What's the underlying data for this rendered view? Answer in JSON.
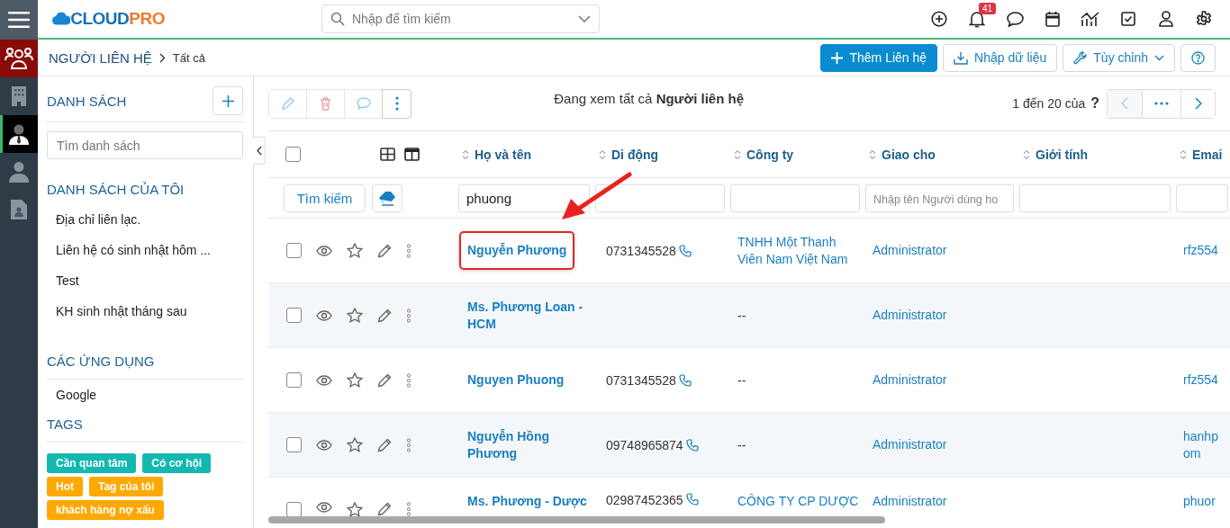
{
  "rail": [
    {
      "kind": "menu",
      "selected": false
    },
    {
      "kind": "module",
      "selected": false
    },
    {
      "kind": "organizations",
      "selected": false
    },
    {
      "kind": "contacts",
      "selected": true
    },
    {
      "kind": "leads",
      "selected": false
    },
    {
      "kind": "documents",
      "selected": false
    }
  ],
  "topbar": {
    "logo": {
      "part_1": "CLOUD",
      "part_2": "PRO"
    },
    "search": {
      "placeholder": "Nhập để tìm kiếm"
    },
    "icons": [
      {
        "kind": "add"
      },
      {
        "kind": "notifications",
        "badge": "41"
      },
      {
        "kind": "chat"
      },
      {
        "kind": "calendar"
      },
      {
        "kind": "reports"
      },
      {
        "kind": "tasks"
      },
      {
        "kind": "profile"
      },
      {
        "kind": "settings"
      }
    ]
  },
  "breadcrumb": {
    "module": "NGƯỜI LIÊN HỆ",
    "view": "Tất cả"
  },
  "actions": [
    {
      "kind": "primary",
      "label": "Thêm Liên hệ"
    },
    {
      "kind": "import",
      "label": "Nhập dữ liệu"
    },
    {
      "kind": "dropdown",
      "label": "Tùy chỉnh"
    },
    {
      "kind": "help"
    }
  ],
  "sidebar": {
    "lists_title": "DANH SÁCH",
    "list_search": {
      "placeholder": "Tìm danh sách"
    },
    "my_lists_title": "DANH SÁCH CỦA TÔI",
    "my_lists": [
      "Địa chỉ liên lạc.",
      "Liên hệ có sinh nhật hôm ...",
      "Test",
      "KH sinh nhật tháng sau"
    ],
    "apps_title": "CÁC ỨNG DỤNG",
    "apps": [
      "Google"
    ],
    "tags_title": "TAGS",
    "tags": [
      {
        "label": "Cần quan tâm",
        "color": "#14b8b0"
      },
      {
        "label": "Có cơ hội",
        "color": "#14b8b0"
      },
      {
        "label": "Hot",
        "color": "#ffa800"
      },
      {
        "label": "Tag của tôi",
        "color": "#ffa800"
      },
      {
        "label": "khách hàng nợ xấu",
        "color": "#ffa800"
      }
    ]
  },
  "toolbar": {
    "status": "Đang xem tất cả **Người liên hệ**",
    "range": "1 đến 20 của",
    "total": "?",
    "pager": [
      {
        "kind": "prev",
        "disabled": true
      },
      {
        "kind": "more",
        "disabled": false
      },
      {
        "kind": "next",
        "disabled": false
      }
    ]
  },
  "table": {
    "select_all": {
      "checked": false
    },
    "columns": [
      "Họ và tên",
      "Di động",
      "Công ty",
      "Giao cho",
      "Giới tính",
      "Emai"
    ],
    "search_button": "Tìm kiếm",
    "filters": [
      {
        "kind": "text",
        "value": "phuong"
      },
      {
        "kind": "text"
      },
      {
        "kind": "text"
      },
      {
        "kind": "text",
        "placeholder": "Nhập tên Người dùng ho"
      },
      {
        "kind": "text"
      },
      {
        "kind": "text"
      }
    ],
    "rows": [
      {
        "checked": false,
        "starred": false,
        "highlighted": true,
        "name": "Nguyễn Phương",
        "mobile": "0731345528",
        "company": "TNHH Một Thanh Viên Nam Việt Nam",
        "assignee": "Administrator",
        "email": "rfz554"
      },
      {
        "checked": false,
        "starred": false,
        "highlighted": false,
        "name": "Ms. Phương Loan - HCM",
        "company": "--",
        "assignee": "Administrator"
      },
      {
        "checked": false,
        "starred": false,
        "highlighted": false,
        "name": "Nguyen Phuong",
        "mobile": "0731345528",
        "company": "--",
        "assignee": "Administrator",
        "email": "rfz554"
      },
      {
        "checked": false,
        "starred": false,
        "highlighted": false,
        "name": "Nguyễn Hồng Phương",
        "mobile": "09748965874",
        "company": "--",
        "assignee": "Administrator",
        "email": "hanhp\nom"
      },
      {
        "checked": false,
        "starred": false,
        "highlighted": false,
        "name": "Ms. Phương - Dược",
        "mobile": "02987452365",
        "company": "CÔNG TY CP DƯỢC",
        "assignee": "Administrator",
        "email": "phuor"
      }
    ]
  }
}
